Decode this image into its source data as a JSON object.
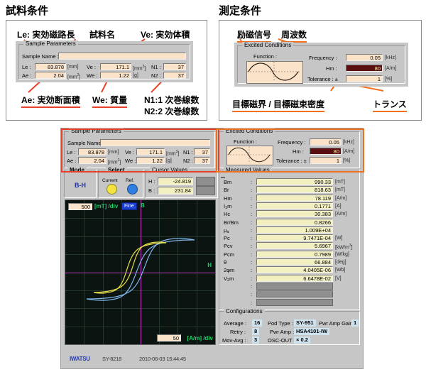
{
  "annotations": {
    "left_section_title": "試料条件",
    "right_section_title": "測定条件",
    "left_labels": {
      "le": "Le: 実効磁路長",
      "sample_name": "試料名",
      "ve": "Ve: 実効体積",
      "ae": "Ae: 実効断面積",
      "we": "We: 質量",
      "n1": "N1:1 次巻線数",
      "n2": "N2:2 次巻線数"
    },
    "right_labels": {
      "excitation": "励磁信号",
      "frequency": "周波数",
      "target_field": "目標磁界 / 目標磁束密度",
      "tolerance": "トランス"
    }
  },
  "sample_parameters": {
    "group_title": "Sample Parameters",
    "sample_name_label": "Sample Name :",
    "sample_name_value": "",
    "rows": [
      {
        "label": "Le :",
        "value": "83.878",
        "unit": "[mm]"
      },
      {
        "label": "Ve :",
        "value": "171.1",
        "unit": "[mm3]"
      },
      {
        "label": "N1 :",
        "value": "37",
        "unit": ""
      },
      {
        "label": "Ae :",
        "value": "2.04",
        "unit": "[mm2]"
      },
      {
        "label": "We :",
        "value": "1.22",
        "unit": "[g]"
      },
      {
        "label": "N2 :",
        "value": "37",
        "unit": ""
      }
    ]
  },
  "excited_conditions": {
    "group_title": "Excited Conditions",
    "function_label": "Function :",
    "rows": [
      {
        "label": "Frequency :",
        "value": "0.05",
        "unit": "[kHz]",
        "highlight": false
      },
      {
        "label": "Hm  :",
        "value": "80",
        "unit": "[A/m]",
        "highlight": true
      },
      {
        "label": "Tolerance : ±",
        "value": "1",
        "unit": "[%]",
        "highlight": false
      }
    ]
  },
  "mode_panel": {
    "group_title": "Mode",
    "value": "B-H"
  },
  "select_panel": {
    "group_title": "Select",
    "current_label": "Current",
    "ref_label": "Ref.",
    "current_color": "#f5e23c",
    "ref_color": "#2f7fe0"
  },
  "cursor_values": {
    "group_title": "Cursor Values",
    "rows": [
      {
        "label": "H :",
        "value": "-24.819"
      },
      {
        "label": "B :",
        "value": "231.84"
      }
    ]
  },
  "graph": {
    "y_scale_value": "500",
    "y_scale_unit": "[mT] /div",
    "fine_label": "Fine",
    "y_axis_label": "B",
    "x_axis_label": "H",
    "x_scale_value": "50",
    "x_scale_unit": "[A/m] /div"
  },
  "measured_values": {
    "group_title": "Measured Values",
    "rows": [
      {
        "label": "Bm",
        "value": "990.33",
        "unit": "[mT]"
      },
      {
        "label": "Br",
        "value": "818.63",
        "unit": "[mT]"
      },
      {
        "label": "Hm",
        "value": "78.119",
        "unit": "[A/m]"
      },
      {
        "label": "I1m",
        "value": "0.1771",
        "unit": "[A]"
      },
      {
        "label": "Hc",
        "value": "30.383",
        "unit": "[A/m]"
      },
      {
        "label": "Br/Bm",
        "value": "0.8266",
        "unit": ""
      },
      {
        "label": "μa",
        "value": "1.009E+04",
        "unit": ""
      },
      {
        "label": "Pc",
        "value": "9.7471E-04",
        "unit": "[W]"
      },
      {
        "label": "Pcv",
        "value": "5.6967",
        "unit": "[kW/m3]"
      },
      {
        "label": "Pcm",
        "value": "0.7989",
        "unit": "[W/kg]"
      },
      {
        "label": "θ",
        "value": "66.884",
        "unit": "[deg]"
      },
      {
        "label": "2φm",
        "value": "4.0405E-06",
        "unit": "[Wb]"
      },
      {
        "label": "V2m",
        "value": "6.6478E-02",
        "unit": "[V]"
      },
      {
        "label": "",
        "value": "",
        "unit": ""
      },
      {
        "label": "",
        "value": "",
        "unit": ""
      },
      {
        "label": "",
        "value": "",
        "unit": ""
      }
    ]
  },
  "configurations": {
    "group_title": "Configurations",
    "items": [
      {
        "label": "Average :",
        "value": "16"
      },
      {
        "label": "Pod Type :",
        "value": "SY-951"
      },
      {
        "label": "Pwr Amp Gain :",
        "value": "1"
      },
      {
        "label": "Retry :",
        "value": "8"
      },
      {
        "label": "Pwr Amp :",
        "value": "HSA4101-IW"
      },
      {
        "label": "Mov-Avg :",
        "value": "3"
      },
      {
        "label": "OSC-OUT :",
        "value": "× 0.2"
      }
    ]
  },
  "status_bar": {
    "brand": "IWATSU",
    "model": "SY-8218",
    "timestamp": "2010-06-03 15:44:45"
  },
  "colors": {
    "accent_red": "#e8402a",
    "accent_orange": "#f07020",
    "panel": "#c6c6c6",
    "field": "#fae3c8"
  }
}
